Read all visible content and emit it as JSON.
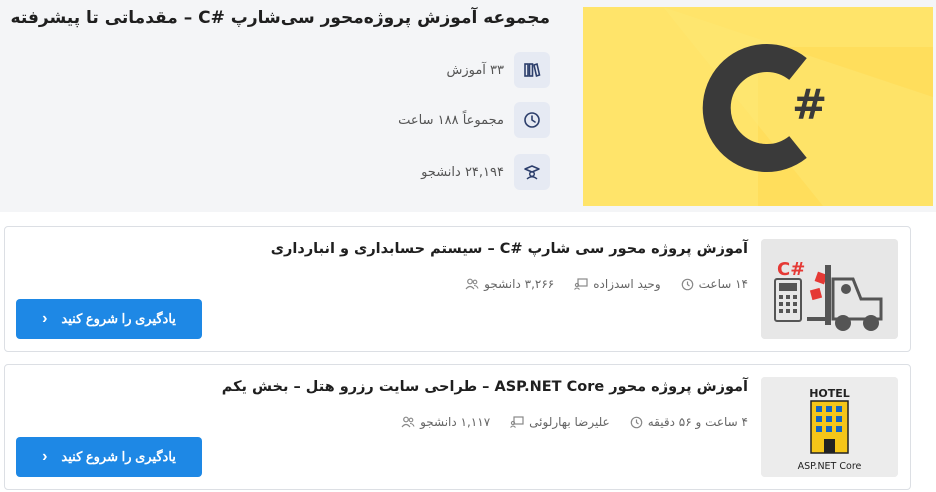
{
  "hero": {
    "title": "مجموعه آموزش پروژه‌محور سی‌شارپ #C – مقدماتی تا پیشرفته",
    "logo_text": "C#",
    "stats": [
      {
        "icon": "books-icon",
        "text": "۳۳ آموزش"
      },
      {
        "icon": "clock-icon",
        "text": "مجموعاً ۱۸۸ ساعت"
      },
      {
        "icon": "graduate-icon",
        "text": "۲۴,۱۹۴ دانشجو"
      }
    ]
  },
  "courses": [
    {
      "title": "آموزش پروژه محور سی شارپ #C – سیستم حسابداری و انبارداری",
      "students": "۳,۲۶۶ دانشجو",
      "teacher": "وحید اسدزاده",
      "duration": "۱۴ ساعت",
      "thumb_text": "C#",
      "cta": "یادگیری را شروع کنید"
    },
    {
      "title": "آموزش پروژه محور ASP.NET Core – طراحی سایت رزرو هتل – بخش یکم",
      "students": "۱,۱۱۷ دانشجو",
      "teacher": "علیرضا بهارلوئی",
      "duration": "۴ ساعت و ۵۶ دقیقه",
      "thumb_text": "HOTEL",
      "thumb_subtext": "ASP.NET Core",
      "cta": "یادگیری را شروع کنید"
    }
  ],
  "colors": {
    "accent": "#1e88e5",
    "hero_bg": "#ffe46a",
    "logo": "#3a3a3a"
  }
}
